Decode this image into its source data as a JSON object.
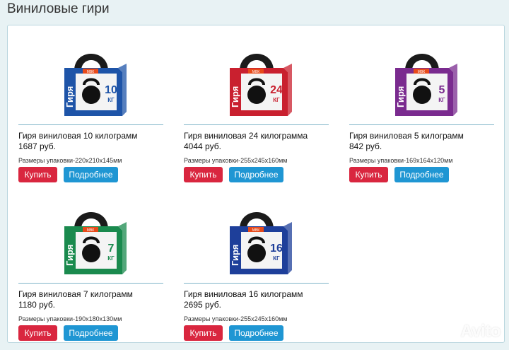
{
  "page": {
    "title": "Виниловые гири"
  },
  "buttons": {
    "buy": "Купить",
    "more": "Подробнее"
  },
  "products": [
    {
      "name": "Гиря виниловая 10 килограмм",
      "price": "1687 руб.",
      "dims": "Размеры упаковки-220х210х145мм",
      "box_color": "#1e54a8",
      "weight_label": "10",
      "unit": "КГ",
      "box_word": "Гиря",
      "brand_tag": "МВК"
    },
    {
      "name": "Гиря виниловая 24 килограмма",
      "price": "4044 руб.",
      "dims": "Размеры упаковки-255х245х160мм",
      "box_color": "#c9202f",
      "weight_label": "24",
      "unit": "КГ",
      "box_word": "Гиря",
      "brand_tag": "МВК"
    },
    {
      "name": "Гиря виниловая 5 килограмм",
      "price": "842 руб.",
      "dims": "Размеры упаковки-169х164х120мм",
      "box_color": "#7a2b8f",
      "weight_label": "5",
      "unit": "КГ",
      "box_word": "Гиря",
      "brand_tag": "МВК"
    },
    {
      "name": "Гиря виниловая 7 килограмм",
      "price": "1180 руб.",
      "dims": "Размеры упаковки-190х180х130мм",
      "box_color": "#1a8a4e",
      "weight_label": "7",
      "unit": "КГ",
      "box_word": "Гиря",
      "brand_tag": "МВК"
    },
    {
      "name": "Гиря виниловая 16 килограмм",
      "price": "2695 руб.",
      "dims": "Размеры упаковки-255х245х160мм",
      "box_color": "#1e3f9a",
      "weight_label": "16",
      "unit": "КГ",
      "box_word": "Гиря",
      "brand_tag": "МВК"
    }
  ],
  "watermark": {
    "text": "Avito"
  }
}
